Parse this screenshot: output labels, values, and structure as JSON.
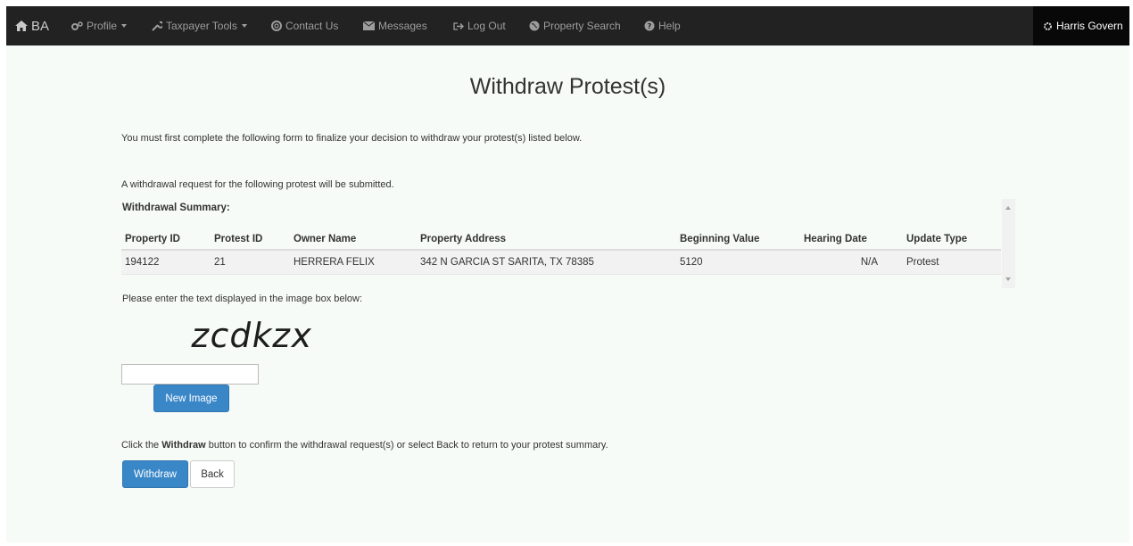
{
  "nav": {
    "brand": "BA",
    "profile": "Profile",
    "taxpayer_tools": "Taxpayer Tools",
    "contact_us": "Contact Us",
    "messages": "Messages",
    "log_out": "Log Out",
    "property_search": "Property Search",
    "help": "Help",
    "user": "Harris Govern"
  },
  "page": {
    "title": "Withdraw Protest(s)",
    "intro": "You must first complete the following form to finalize your decision to withdraw your protest(s) listed below.",
    "request_note": "A withdrawal request for the following protest will be submitted.",
    "summary_label": "Withdrawal Summary:"
  },
  "table": {
    "headers": [
      "Property ID",
      "Protest ID",
      "Owner Name",
      "Property Address",
      "Beginning Value",
      "Hearing Date",
      "Update Type"
    ],
    "rows": [
      [
        "194122",
        "21",
        "HERRERA FELIX",
        "342 N GARCIA ST SARITA, TX 78385",
        "5120",
        "N/A",
        "Protest"
      ]
    ]
  },
  "captcha": {
    "prompt": "Please enter the text displayed in the image box below:",
    "image_text": "zcdkzx",
    "input_value": "",
    "new_image_label": "New Image"
  },
  "confirm": {
    "text_before": "Click the ",
    "text_bold": "Withdraw",
    "text_after": " button to confirm the withdrawal request(s) or select Back to return to your protest summary.",
    "withdraw_label": "Withdraw",
    "back_label": "Back"
  }
}
